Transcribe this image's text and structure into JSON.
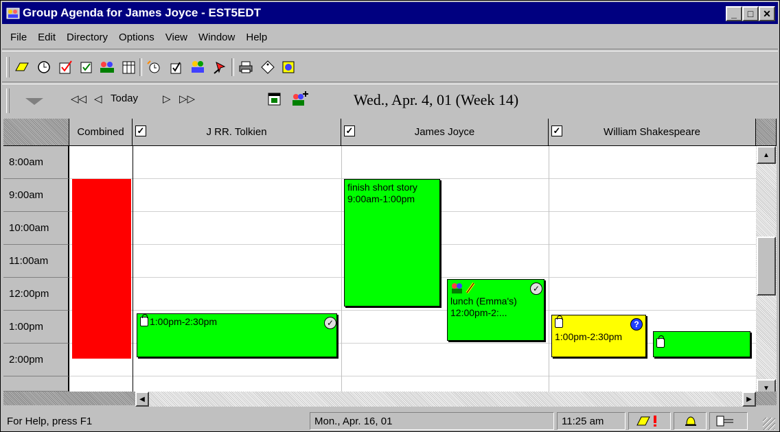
{
  "window": {
    "title": "Group Agenda for James Joyce  - EST5EDT"
  },
  "menu": [
    "File",
    "Edit",
    "Directory",
    "Options",
    "View",
    "Window",
    "Help"
  ],
  "toolbar_icons": [
    "eraser-icon",
    "clock-icon",
    "checkbox-icon",
    "group-icon",
    "calendar-grid-icon",
    "alarm-icon",
    "task-icon",
    "meeting-icon",
    "pin-icon",
    "printer-icon",
    "tag-icon",
    "help-icon"
  ],
  "nav": {
    "today": "Today",
    "date_heading": "Wed., Apr. 4, 01  (Week 14)"
  },
  "columns": [
    {
      "label": "Combined",
      "checkbox": false
    },
    {
      "label": "J RR. Tolkien",
      "checkbox": true
    },
    {
      "label": "James Joyce",
      "checkbox": true
    },
    {
      "label": "William Shakespeare",
      "checkbox": true
    }
  ],
  "times": [
    "8:00am",
    "9:00am",
    "10:00am",
    "11:00am",
    "12:00pm",
    "1:00pm",
    "2:00pm"
  ],
  "appointments": {
    "tolkien_1": {
      "text": "1:00pm-2:30pm"
    },
    "joyce_story": {
      "text": " finish short story 9:00am-1:00pm"
    },
    "joyce_lunch": {
      "text": "lunch (Emma's) 12:00pm-2:..."
    },
    "shakespeare_1": {
      "text": "1:00pm-2:30pm"
    }
  },
  "colors": {
    "accent": "#000080",
    "busy": "#ff0000",
    "appointment": "#00ff00",
    "tentative": "#ffff00"
  },
  "status": {
    "help": "For Help, press F1",
    "date": "Mon., Apr. 16, 01",
    "time": "11:25 am"
  }
}
